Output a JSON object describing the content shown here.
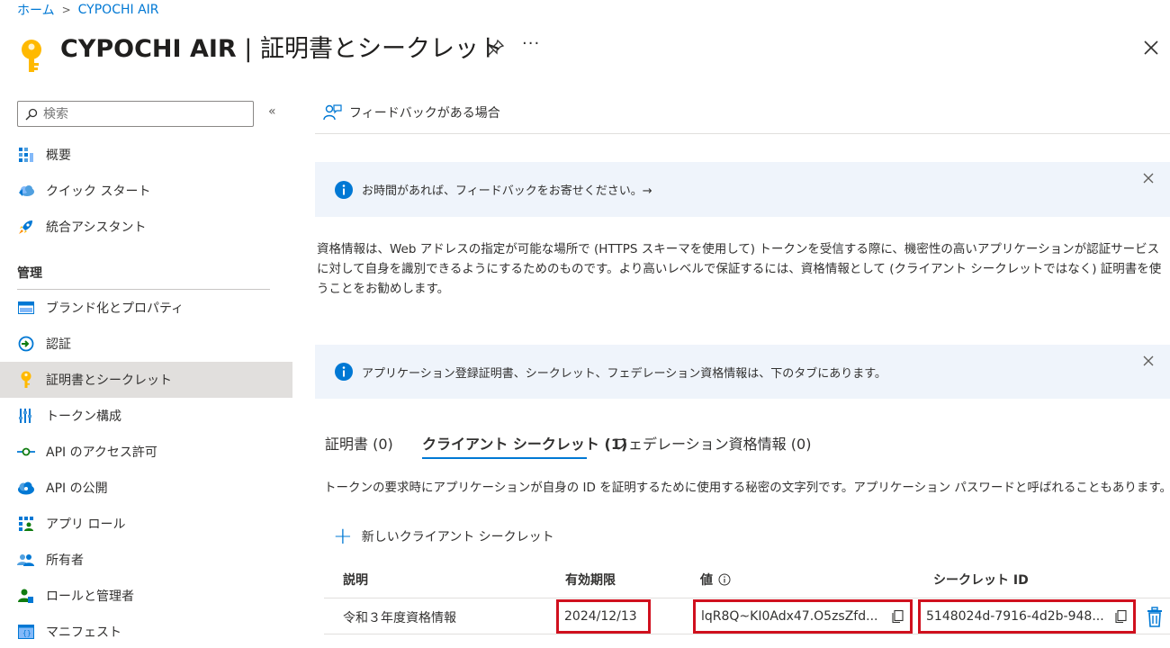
{
  "breadcrumb": {
    "home": "ホーム",
    "app": "CYPOCHI AIR"
  },
  "header": {
    "app_name": "CYPOCHI AIR",
    "separator": " | ",
    "page_name": "証明書とシークレット",
    "more": "···"
  },
  "sidebar": {
    "search_placeholder": "検索",
    "collapse": "«",
    "items_top": [
      {
        "label": "概要",
        "icon": "overview-icon"
      },
      {
        "label": "クイック スタート",
        "icon": "quickstart-cloud-icon"
      },
      {
        "label": "統合アシスタント",
        "icon": "rocket-icon"
      }
    ],
    "section_manage": "管理",
    "items_manage": [
      {
        "label": "ブランド化とプロパティ",
        "icon": "branding-icon"
      },
      {
        "label": "認証",
        "icon": "authentication-icon"
      },
      {
        "label": "証明書とシークレット",
        "icon": "key-icon",
        "active": true
      },
      {
        "label": "トークン構成",
        "icon": "token-config-icon"
      },
      {
        "label": "API のアクセス許可",
        "icon": "api-permissions-icon"
      },
      {
        "label": "API の公開",
        "icon": "expose-api-icon"
      },
      {
        "label": "アプリ ロール",
        "icon": "app-roles-icon"
      },
      {
        "label": "所有者",
        "icon": "owners-icon"
      },
      {
        "label": "ロールと管理者",
        "icon": "roles-admins-icon"
      },
      {
        "label": "マニフェスト",
        "icon": "manifest-icon"
      }
    ]
  },
  "main": {
    "feedback_label": "フィードバックがある場合",
    "banner1": "お時間があれば、フィードバックをお寄せください。→",
    "description": "資格情報は、Web アドレスの指定が可能な場所で (HTTPS スキーマを使用して) トークンを受信する際に、機密性の高いアプリケーションが認証サービスに対して自身を識別できるようにするためのものです。より高いレベルで保証するには、資格情報として (クライアント シークレットではなく) 証明書を使うことをお勧めします。",
    "banner2": "アプリケーション登録証明書、シークレット、フェデレーション資格情報は、下のタブにあります。",
    "tabs": [
      {
        "label": "証明書 (0)"
      },
      {
        "label": "クライアント シークレット (1)",
        "active": true
      },
      {
        "label": "フェデレーション資格情報 (0)"
      }
    ],
    "tab_description": "トークンの要求時にアプリケーションが自身の ID を証明するために使用する秘密の文字列です。アプリケーション パスワードと呼ばれることもあります。",
    "new_secret_plus": "+",
    "new_secret_label": "新しいクライアント シークレット",
    "table": {
      "headers": {
        "description": "説明",
        "expires": "有効期限",
        "value": "値",
        "secret_id": "シークレット ID"
      },
      "rows": [
        {
          "description": "令和３年度資格情報",
          "expires": "2024/12/13",
          "value": "lqR8Q~KI0Adx47.O5zsZfd...",
          "secret_id": "5148024d-7916-4d2b-948..."
        }
      ]
    }
  },
  "colors": {
    "accent": "#0078d4",
    "highlight": "#d0101e",
    "info_bg": "#eff4fb",
    "active_nav": "#e1dfdd"
  }
}
